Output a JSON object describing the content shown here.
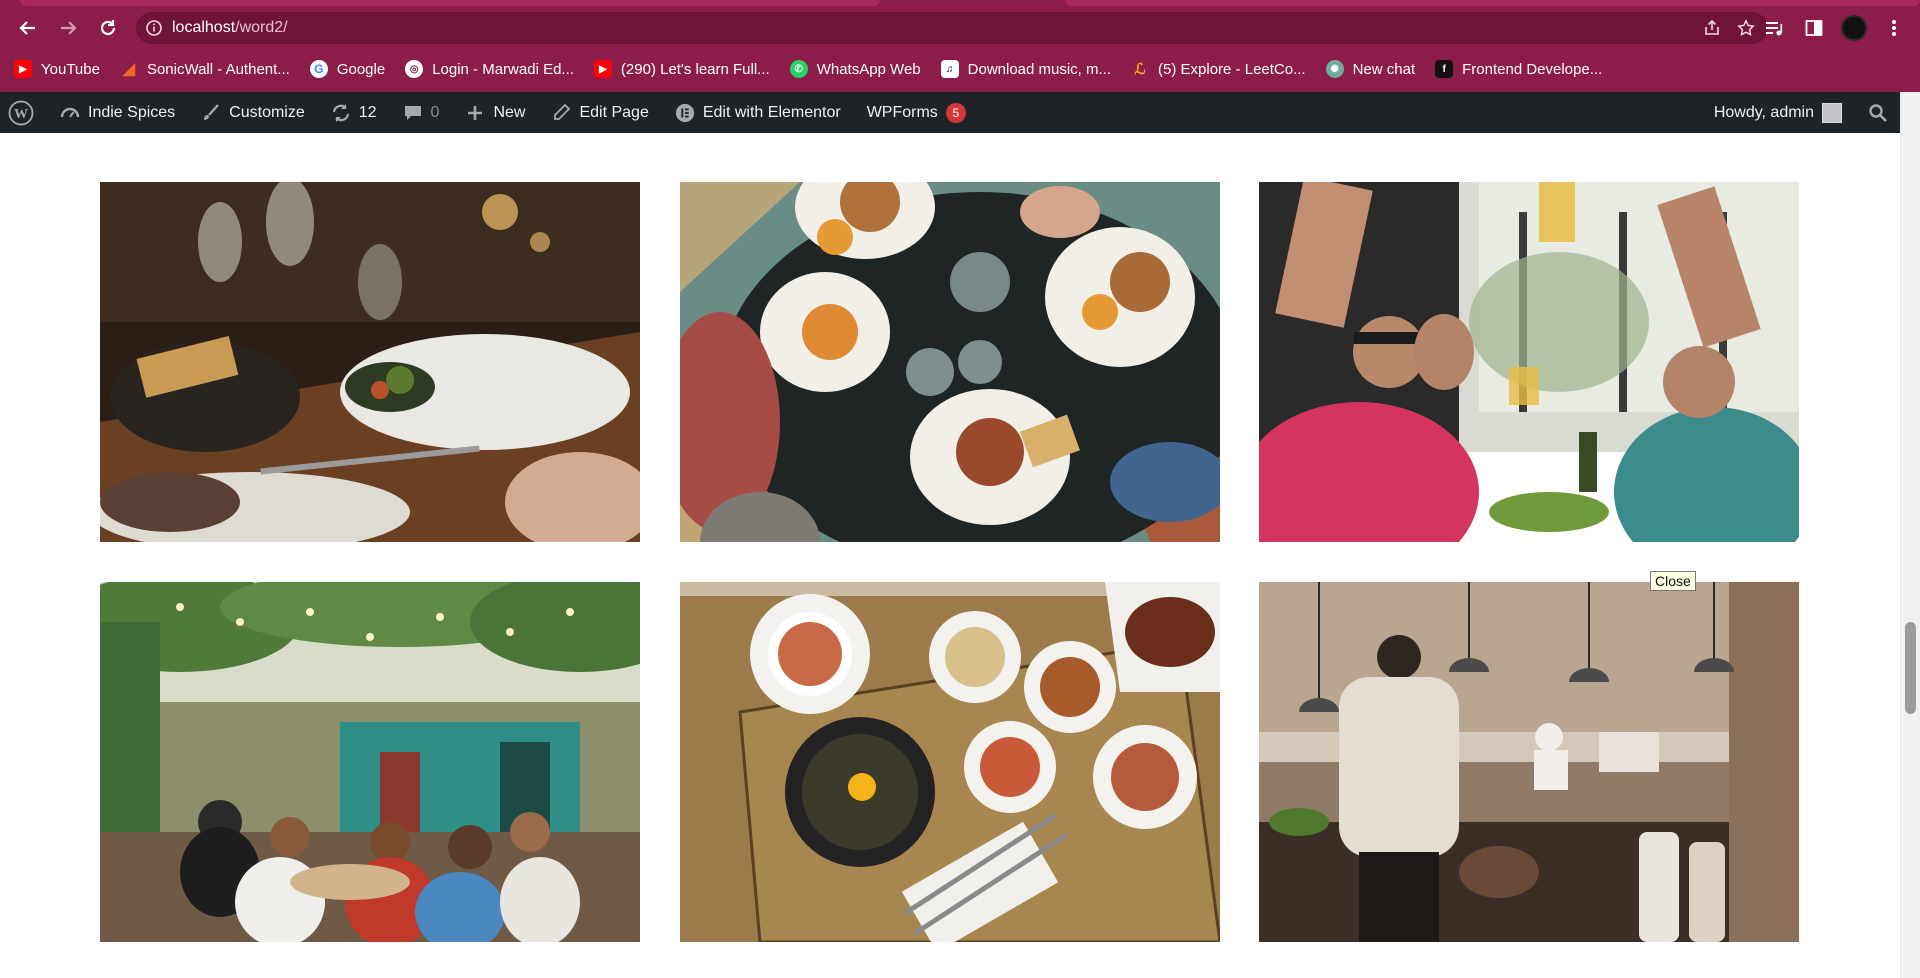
{
  "browser": {
    "url_host": "localhost",
    "url_path": "/word2/",
    "bookmarks": [
      {
        "label": "YouTube",
        "icon": "youtube-icon",
        "color": "#ff0000"
      },
      {
        "label": "SonicWall - Authent...",
        "icon": "sonicwall-icon",
        "color": "#f26522"
      },
      {
        "label": "Google",
        "icon": "google-icon",
        "color": "#4285f4"
      },
      {
        "label": "Login - Marwadi Ed...",
        "icon": "globe-icon",
        "color": "#ffffff"
      },
      {
        "label": "(290) Let's learn Full...",
        "icon": "youtube-icon",
        "color": "#ff0000"
      },
      {
        "label": "WhatsApp Web",
        "icon": "whatsapp-icon",
        "color": "#25d366"
      },
      {
        "label": "Download music, m...",
        "icon": "music-site-icon",
        "color": "#ffffff"
      },
      {
        "label": "(5) Explore - LeetCo...",
        "icon": "leetcode-icon",
        "color": "#ffa116"
      },
      {
        "label": "New chat",
        "icon": "chatgpt-icon",
        "color": "#74aa9c"
      },
      {
        "label": "Frontend Develope...",
        "icon": "frontend-site-icon",
        "color": "#111111"
      }
    ]
  },
  "adminbar": {
    "site_name": "Indie Spices",
    "customize": "Customize",
    "updates_count": "12",
    "comments_count": "0",
    "new": "New",
    "edit_page": "Edit Page",
    "edit_elementor": "Edit with Elementor",
    "wpforms": "WPForms",
    "wpforms_badge": "5",
    "howdy": "Howdy, admin"
  },
  "gallery": {
    "images": [
      {
        "name": "fine-dining-table-photo"
      },
      {
        "name": "burgers-fries-overhead-photo"
      },
      {
        "name": "friends-toasting-photo"
      },
      {
        "name": "garden-restaurant-photo"
      },
      {
        "name": "korean-dishes-overhead-photo"
      },
      {
        "name": "chef-in-kitchen-photo"
      }
    ]
  },
  "tooltip": {
    "text": "Close"
  }
}
